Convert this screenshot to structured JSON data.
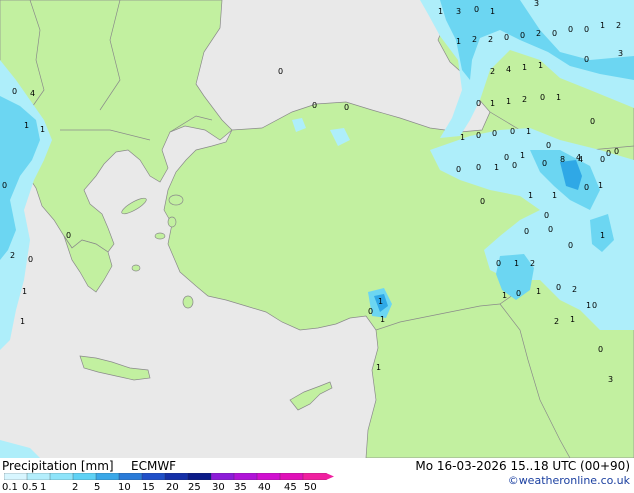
{
  "footer": {
    "title": "Precipitation [mm]",
    "model": "ECMWF",
    "valid_time": "Mo 16-03-2026 15..18 UTC (00+90)",
    "credit": "©weatheronline.co.uk"
  },
  "legend": {
    "ticks": [
      "0.1",
      "0.5",
      "1",
      "2",
      "5",
      "10",
      "15",
      "20",
      "25",
      "30",
      "35",
      "40",
      "45",
      "50"
    ],
    "colors": [
      "#d8f6ff",
      "#b4eefc",
      "#8ee4fa",
      "#5fd2f5",
      "#3aa8e8",
      "#2a7bd8",
      "#1f4fc8",
      "#1530a8",
      "#0b1b88",
      "#8c1cd8",
      "#b014d8",
      "#d010d0",
      "#e010b8",
      "#f020a0"
    ]
  },
  "map": {
    "colors": {
      "sea": "#e9e9e9",
      "land": "#c2f0a0",
      "border": "#8a8a8a",
      "precip_light": "#aeeefa",
      "precip_mid": "#6cd6f2",
      "precip_heavy": "#2fa8e6"
    },
    "labels": [
      {
        "t": "1"
      },
      {
        "t": "3"
      },
      {
        "t": "0"
      },
      {
        "t": "1"
      },
      {
        "t": "3"
      },
      {
        "t": "1"
      },
      {
        "t": "2"
      },
      {
        "t": "2"
      },
      {
        "t": "0"
      },
      {
        "t": "0"
      },
      {
        "t": "2"
      },
      {
        "t": "0"
      },
      {
        "t": "0"
      },
      {
        "t": "0"
      },
      {
        "t": "1"
      },
      {
        "t": "2"
      },
      {
        "t": "2"
      },
      {
        "t": "4"
      },
      {
        "t": "1"
      },
      {
        "t": "1"
      },
      {
        "t": "0"
      },
      {
        "t": "3"
      },
      {
        "t": "0"
      },
      {
        "t": "1"
      },
      {
        "t": "1"
      },
      {
        "t": "2"
      },
      {
        "t": "0"
      },
      {
        "t": "1"
      },
      {
        "t": "0"
      },
      {
        "t": "0"
      },
      {
        "t": "0"
      },
      {
        "t": "1"
      },
      {
        "t": "0"
      },
      {
        "t": "0"
      },
      {
        "t": "0"
      },
      {
        "t": "1"
      },
      {
        "t": "0"
      },
      {
        "t": "0"
      },
      {
        "t": "1"
      },
      {
        "t": "0"
      },
      {
        "t": "4"
      },
      {
        "t": "0"
      },
      {
        "t": "0"
      },
      {
        "t": "0"
      },
      {
        "t": "0"
      },
      {
        "t": "1"
      },
      {
        "t": "0"
      },
      {
        "t": "0"
      },
      {
        "t": "8"
      },
      {
        "t": "4"
      },
      {
        "t": "0"
      },
      {
        "t": "1"
      },
      {
        "t": "1"
      },
      {
        "t": "0"
      },
      {
        "t": "1"
      },
      {
        "t": "0"
      },
      {
        "t": "0"
      },
      {
        "t": "0"
      },
      {
        "t": "0"
      },
      {
        "t": "0"
      },
      {
        "t": "1"
      },
      {
        "t": "0"
      },
      {
        "t": "1"
      },
      {
        "t": "2"
      },
      {
        "t": "1"
      },
      {
        "t": "0"
      },
      {
        "t": "1"
      },
      {
        "t": "0"
      },
      {
        "t": "4"
      },
      {
        "t": "1"
      },
      {
        "t": "1"
      },
      {
        "t": "0"
      },
      {
        "t": "2"
      },
      {
        "t": "0"
      },
      {
        "t": "0"
      },
      {
        "t": "1"
      },
      {
        "t": "1"
      },
      {
        "t": "1"
      },
      {
        "t": "1"
      },
      {
        "t": "1"
      },
      {
        "t": "2"
      },
      {
        "t": "1"
      },
      {
        "t": "1"
      },
      {
        "t": "0"
      },
      {
        "t": "3"
      },
      {
        "t": "0"
      },
      {
        "t": "0"
      },
      {
        "t": "2"
      },
      {
        "t": "0"
      },
      {
        "t": "0"
      },
      {
        "t": "0"
      }
    ]
  }
}
